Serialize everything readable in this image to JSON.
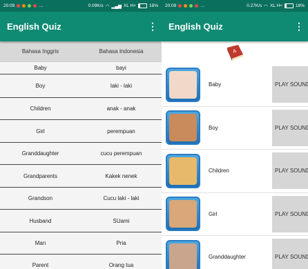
{
  "left": {
    "status": {
      "time": "20:09",
      "speed": "0.09K/s",
      "network": "XL H+",
      "battery": "18%"
    },
    "title": "English Quiz",
    "menu_icon": "⋮",
    "headers": [
      "Bahasa Inggris",
      "Bahasa Indonesia"
    ],
    "rows": [
      [
        "Baby",
        "bayi"
      ],
      [
        "Boy",
        "laki - laki"
      ],
      [
        "Children",
        "anak - anak"
      ],
      [
        "Girl",
        "perempuan"
      ],
      [
        "Granddaughter",
        "cucu perempuan"
      ],
      [
        "Grandparents",
        "Kakek nenek"
      ],
      [
        "Grandson",
        "Cucu laki - laki"
      ],
      [
        "Husband",
        "SUami"
      ],
      [
        "Man",
        "Pria"
      ],
      [
        "Parent",
        "Orang tua"
      ]
    ]
  },
  "right": {
    "status": {
      "time": "20:09",
      "speed": "0.27K/s",
      "network": "XL H+",
      "battery": "18%"
    },
    "title": "English Quiz",
    "menu_icon": "⋮",
    "book_icon": "book-icon",
    "play_label": "PLAY SOUND",
    "items": [
      {
        "word": "Baby",
        "thumb_color": "#f1d9c9"
      },
      {
        "word": "Boy",
        "thumb_color": "#c98a5c"
      },
      {
        "word": "Children",
        "thumb_color": "#e7b96a"
      },
      {
        "word": "Girl",
        "thumb_color": "#d9a778"
      },
      {
        "word": "Granddaughter",
        "thumb_color": "#caa58e"
      }
    ]
  },
  "colors": {
    "appbar": "#0f8a73",
    "statusbar": "#0b6f5d"
  }
}
